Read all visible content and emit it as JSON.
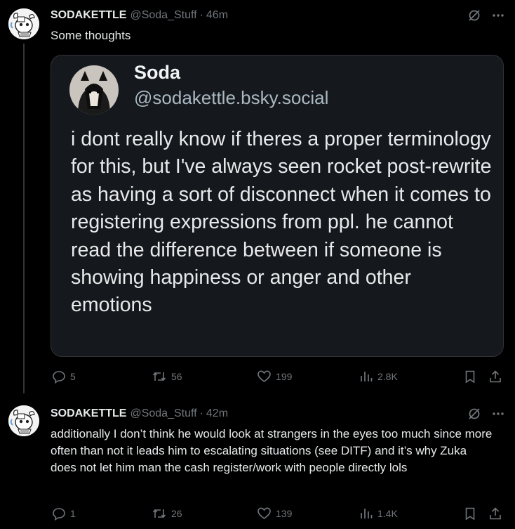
{
  "posts": [
    {
      "author": "SODAKETTLE",
      "handle": "@Soda_Stuff",
      "separator": "·",
      "time": "46m",
      "text": "Some thoughts",
      "quote": {
        "name": "Soda",
        "handle": "@sodakettle.bsky.social",
        "text": "i dont really know if theres a proper terminology for this, but I've always seen rocket post-rewrite as having a sort of disconnect when it comes to registering expressions from ppl. he cannot read the difference between if someone is showing happiness or anger and other emotions"
      },
      "stats": {
        "replies": "5",
        "reposts": "56",
        "likes": "199",
        "views": "2.8K"
      }
    },
    {
      "author": "SODAKETTLE",
      "handle": "@Soda_Stuff",
      "separator": "·",
      "time": "42m",
      "text": "additionally I don’t think he would look at strangers in the eyes too much since more often than not it leads him to escalating situations (see DITF) and it’s why Zuka does not let him man the cash register/work with people directly lols",
      "stats": {
        "replies": "1",
        "reposts": "26",
        "likes": "139",
        "views": "1.4K"
      }
    }
  ],
  "icons": {
    "reply": "reply-icon",
    "repost": "repost-icon",
    "like": "heart-icon",
    "views": "views-icon",
    "bookmark": "bookmark-icon",
    "share": "share-icon",
    "grok": "grok-icon",
    "more": "more-icon"
  },
  "colors": {
    "background": "#000000",
    "text": "#e7e9ea",
    "muted": "#71767b",
    "quote_bg": "#15181c",
    "border": "#2f3336"
  }
}
